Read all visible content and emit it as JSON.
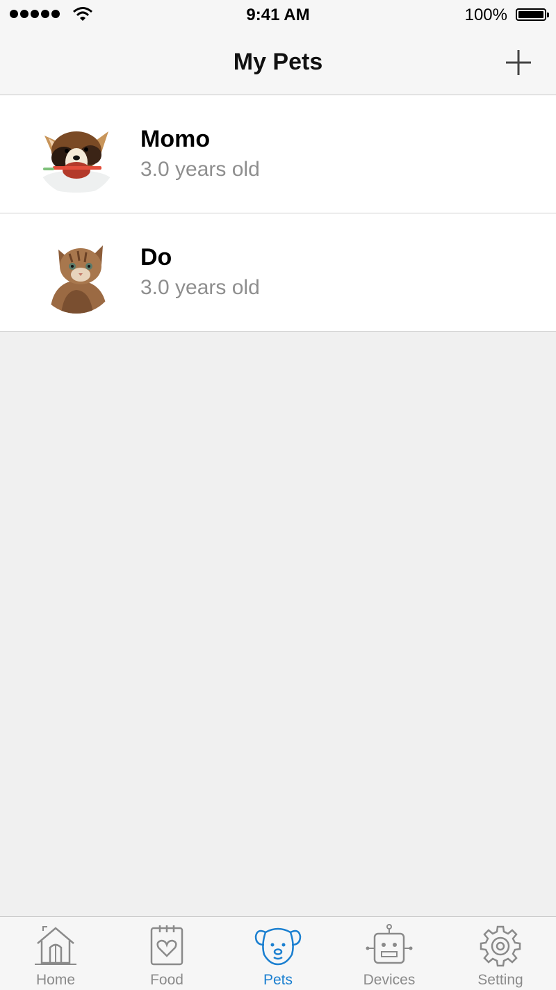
{
  "status_bar": {
    "time": "9:41 AM",
    "battery": "100%"
  },
  "nav": {
    "title": "My Pets",
    "add_icon": "plus-icon"
  },
  "pets": [
    {
      "name": "Momo",
      "age": "3.0 years old",
      "avatar": "corgi-puppy-photo"
    },
    {
      "name": "Do",
      "age": "3.0 years old",
      "avatar": "tabby-kitten-photo"
    }
  ],
  "tabs": [
    {
      "label": "Home",
      "icon": "home-icon",
      "active": false
    },
    {
      "label": "Food",
      "icon": "food-icon",
      "active": false
    },
    {
      "label": "Pets",
      "icon": "dog-icon",
      "active": true
    },
    {
      "label": "Devices",
      "icon": "robot-icon",
      "active": false
    },
    {
      "label": "Setting",
      "icon": "gear-icon",
      "active": false
    }
  ],
  "colors": {
    "accent": "#1a7fd0",
    "inactive": "#8a8a8a",
    "background": "#f0f0f0"
  }
}
